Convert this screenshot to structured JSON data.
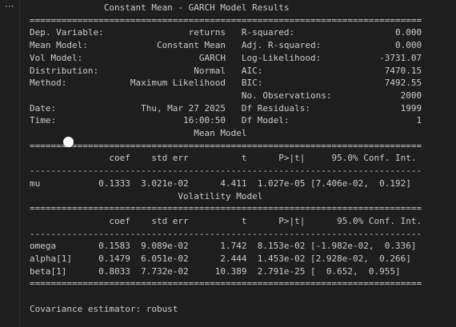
{
  "toolbar": {
    "more_label": "···"
  },
  "output": {
    "lines": [
      "              Constant Mean - GARCH Model Results               ",
      "==========================================================================",
      "Dep. Variable:                returns   R-squared:                   0.000",
      "Mean Model:             Constant Mean   Adj. R-squared:              0.000",
      "Vol Model:                      GARCH   Log-Likelihood:           -3731.07",
      "Distribution:                  Normal   AIC:                       7470.15",
      "Method:            Maximum Likelihood   BIC:                       7492.55",
      "                                        No. Observations:             2000",
      "Date:                Thu, Mar 27 2025   Df Residuals:                 1999",
      "Time:                        16:00:50   Df Model:                        1",
      "                               Mean Model                               ",
      "==========================================================================",
      "               coef    std err          t      P>|t|     95.0% Conf. Int.",
      "--------------------------------------------------------------------------",
      "mu           0.1333  3.021e-02      4.411  1.027e-05 [7.406e-02,  0.192]",
      "                            Volatility Model                            ",
      "==========================================================================",
      "               coef    std err          t      P>|t|      95.0% Conf. Int.",
      "--------------------------------------------------------------------------",
      "omega        0.1583  9.089e-02      1.742  8.153e-02 [-1.982e-02,  0.336]",
      "alpha[1]     0.1479  6.051e-02      2.444  1.453e-02 [2.928e-02,  0.266]",
      "beta[1]      0.8033  7.732e-02     10.389  2.791e-25 [  0.652,  0.955]",
      "==========================================================================",
      "",
      "Covariance estimator: robust"
    ]
  }
}
